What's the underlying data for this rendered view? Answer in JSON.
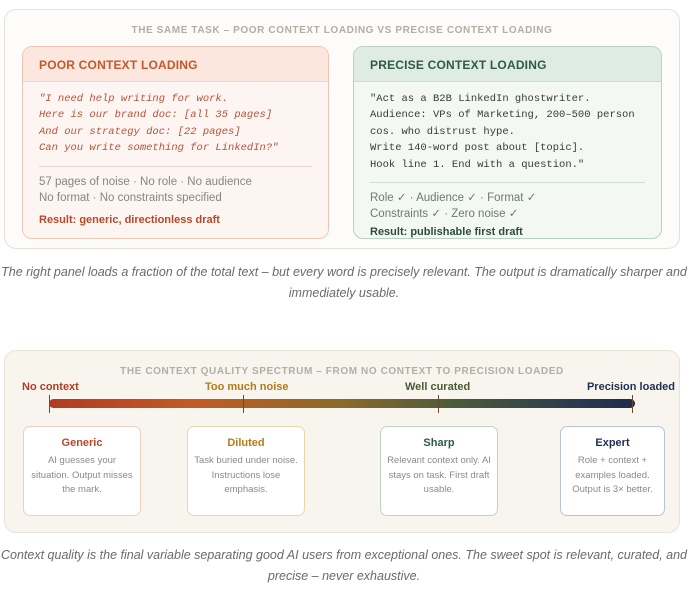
{
  "comparison": {
    "heading": "THE SAME TASK – POOR CONTEXT LOADING VS PRECISE CONTEXT LOADING",
    "poor": {
      "title": "POOR CONTEXT LOADING",
      "prompt": "\"I need help writing for work.\nHere is our brand doc: [all 35 pages]\nAnd our strategy doc: [22 pages]\nCan you write something for LinkedIn?\"",
      "notes_line1": "57 pages of noise · No role · No audience",
      "notes_line2": "No format · No constraints specified",
      "result": "Result: generic, directionless draft"
    },
    "precise": {
      "title": "PRECISE CONTEXT LOADING",
      "prompt": "\"Act as a B2B LinkedIn ghostwriter.\nAudience: VPs of Marketing, 200–500 person\ncos. who distrust hype.\nWrite 140-word post about [topic].\nHook line 1. End with a question.\"",
      "notes_line1": "Role ✓ · Audience ✓ · Format ✓",
      "notes_line2": "Constraints ✓ · Zero noise ✓",
      "result": "Result: publishable first draft"
    },
    "caption": "The right panel loads a fraction of the total text – but every word is precisely relevant. The output is dramatically sharper and immediately usable."
  },
  "spectrum": {
    "heading": "THE CONTEXT QUALITY SPECTRUM – FROM NO CONTEXT TO PRECISION LOADED",
    "labels": {
      "no_context": "No context",
      "noise": "Too much noise",
      "curated": "Well curated",
      "precision": "Precision loaded"
    },
    "cards": {
      "generic": {
        "title": "Generic",
        "desc": "AI guesses your situation. Output misses the mark."
      },
      "diluted": {
        "title": "Diluted",
        "desc": "Task buried under noise. Instructions lose emphasis."
      },
      "sharp": {
        "title": "Sharp",
        "desc": "Relevant context only. AI stays on task. First draft usable."
      },
      "expert": {
        "title": "Expert",
        "desc": "Role + context + examples loaded. Output is 3× better."
      }
    },
    "caption": "Context quality is the final variable separating good AI users from exceptional ones. The sweet spot is relevant, curated, and precise – never exhaustive."
  },
  "colors": {
    "poor_accent": "#c4582d",
    "precise_accent": "#2f5b44",
    "spectrum_start": "#b23a22",
    "spectrum_end": "#1f2b4a"
  }
}
